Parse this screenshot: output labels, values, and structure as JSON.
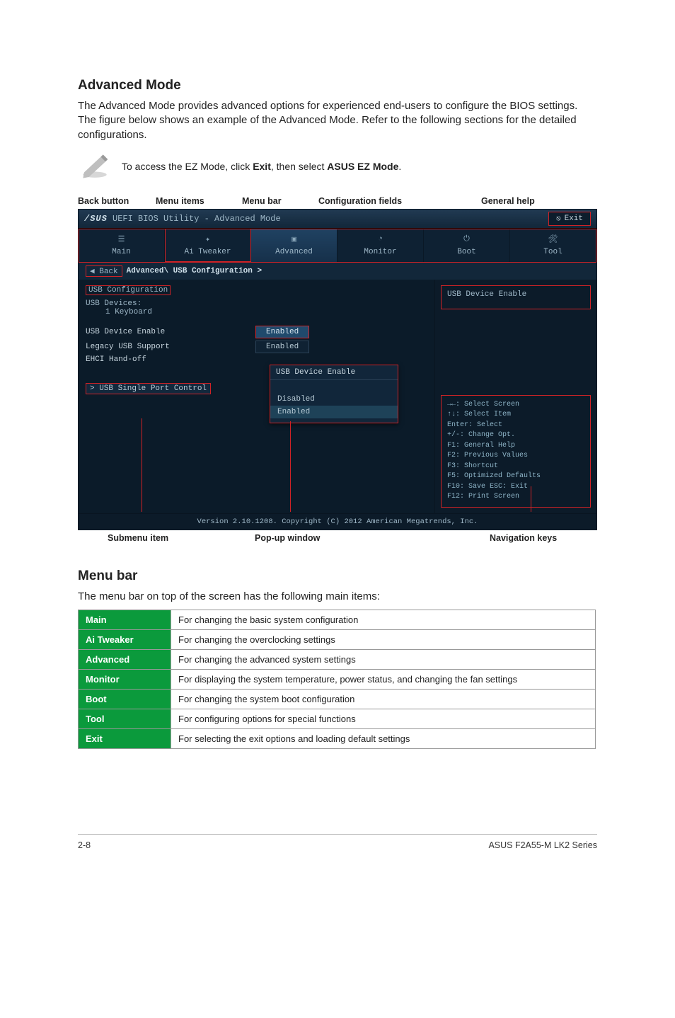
{
  "section1_title": "Advanced Mode",
  "section1_body": "The Advanced Mode provides advanced options for experienced end-users to configure the BIOS settings. The figure below shows an example of the Advanced Mode. Refer to the following sections for the detailed configurations.",
  "note_prefix": "To access the EZ Mode, click ",
  "note_b1": "Exit",
  "note_mid": ", then select ",
  "note_b2": "ASUS EZ Mode",
  "note_suffix": ".",
  "toplabels": {
    "back": "Back button",
    "items": "Menu items",
    "bar": "Menu bar",
    "fields": "Configuration fields",
    "help": "General help"
  },
  "bios": {
    "title": "UEFI BIOS Utility - Advanced Mode",
    "exit": "Exit",
    "tabs": [
      {
        "label": "Main"
      },
      {
        "label": "Ai Tweaker"
      },
      {
        "label": "Advanced"
      },
      {
        "label": "Monitor"
      },
      {
        "label": "Boot"
      },
      {
        "label": "Tool"
      }
    ],
    "crumb_back": "Back",
    "crumb_path": "Advanced\\ USB Configuration >",
    "grp_title": "USB Configuration",
    "dev_label": "USB Devices:",
    "dev_val": "1 Keyboard",
    "rows": [
      {
        "k": "USB Device Enable",
        "v": "Enabled"
      },
      {
        "k": "Legacy USB Support",
        "v": "Enabled"
      },
      {
        "k": "EHCI Hand-off",
        "v": ""
      }
    ],
    "submenu": "> USB Single Port Control",
    "popup_title": "USB Device Enable",
    "popup_opts": [
      "Disabled",
      "Enabled"
    ],
    "help_title": "USB Device Enable",
    "nav": [
      "→←: Select Screen",
      "↑↓: Select Item",
      "Enter: Select",
      "+/-: Change Opt.",
      "F1: General Help",
      "F2: Previous Values",
      "F3: Shortcut",
      "F5: Optimized Defaults",
      "F10: Save  ESC: Exit",
      "F12: Print Screen"
    ],
    "version": "Version 2.10.1208. Copyright (C) 2012 American Megatrends, Inc."
  },
  "botlabels": {
    "sub": "Submenu item",
    "pop": "Pop-up window",
    "nav": "Navigation keys"
  },
  "section2_title": "Menu bar",
  "section2_body": "The menu bar on top of the screen has the following main items:",
  "menutable": [
    {
      "h": "Main",
      "d": "For changing the basic system configuration"
    },
    {
      "h": "Ai Tweaker",
      "d": "For changing the overclocking settings"
    },
    {
      "h": "Advanced",
      "d": "For changing the advanced system settings"
    },
    {
      "h": "Monitor",
      "d": "For displaying the system temperature, power status, and changing the fan settings"
    },
    {
      "h": "Boot",
      "d": "For changing the system boot configuration"
    },
    {
      "h": "Tool",
      "d": "For configuring options for special functions"
    },
    {
      "h": "Exit",
      "d": "For selecting the exit options and loading default settings"
    }
  ],
  "footer_left": "2-8",
  "footer_right": "ASUS F2A55-M LK2 Series"
}
